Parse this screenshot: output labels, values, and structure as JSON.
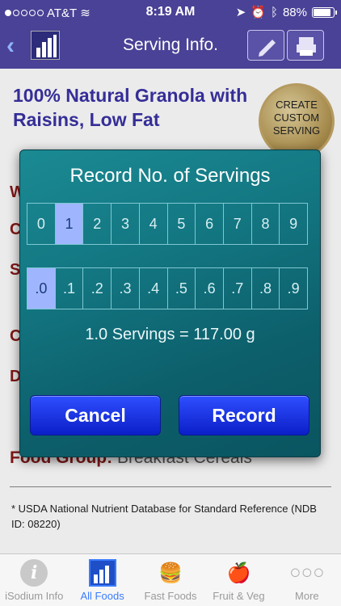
{
  "status": {
    "carrier": "AT&T",
    "time": "8:19 AM",
    "battery": "88%",
    "signal_icon": "signal-dots",
    "wifi_icon": "wifi-icon"
  },
  "nav": {
    "title": "Serving Info.",
    "back_icon": "chevron-left"
  },
  "food": {
    "title": "100% Natural Granola with Raisins, Low Fat",
    "custom_serving": "CREATE CUSTOM SERVING",
    "food_group_label": "Food Group:",
    "food_group_value": "Breakfast Cereals*",
    "footnote": "*  USDA National Nutrient Database for Standard Reference (NDB ID: 08220)"
  },
  "dialog": {
    "title": "Record No. of Servings",
    "whole_numbers": [
      "0",
      "1",
      "2",
      "3",
      "4",
      "5",
      "6",
      "7",
      "8",
      "9"
    ],
    "fractions": [
      ".0",
      ".1",
      ".2",
      ".3",
      ".4",
      ".5",
      ".6",
      ".7",
      ".8",
      ".9"
    ],
    "selected_whole": "1",
    "selected_fraction": ".0",
    "summary": "1.0 Servings = 117.00 g",
    "cancel_label": "Cancel",
    "record_label": "Record"
  },
  "tabs": [
    {
      "label": "iSodium Info",
      "icon": "info-icon"
    },
    {
      "label": "All Foods",
      "icon": "bar-chart-icon",
      "active": true
    },
    {
      "label": "Fast Foods",
      "icon": "fast-food-icon"
    },
    {
      "label": "Fruit & Veg",
      "icon": "apple-icon"
    },
    {
      "label": "More",
      "icon": "more-icon"
    }
  ],
  "colors": {
    "nav": "#4a4296",
    "dialog": "#137782",
    "button": "#1a33e6",
    "selected": "#9fb6ff",
    "accent_title": "#3a32a4"
  }
}
